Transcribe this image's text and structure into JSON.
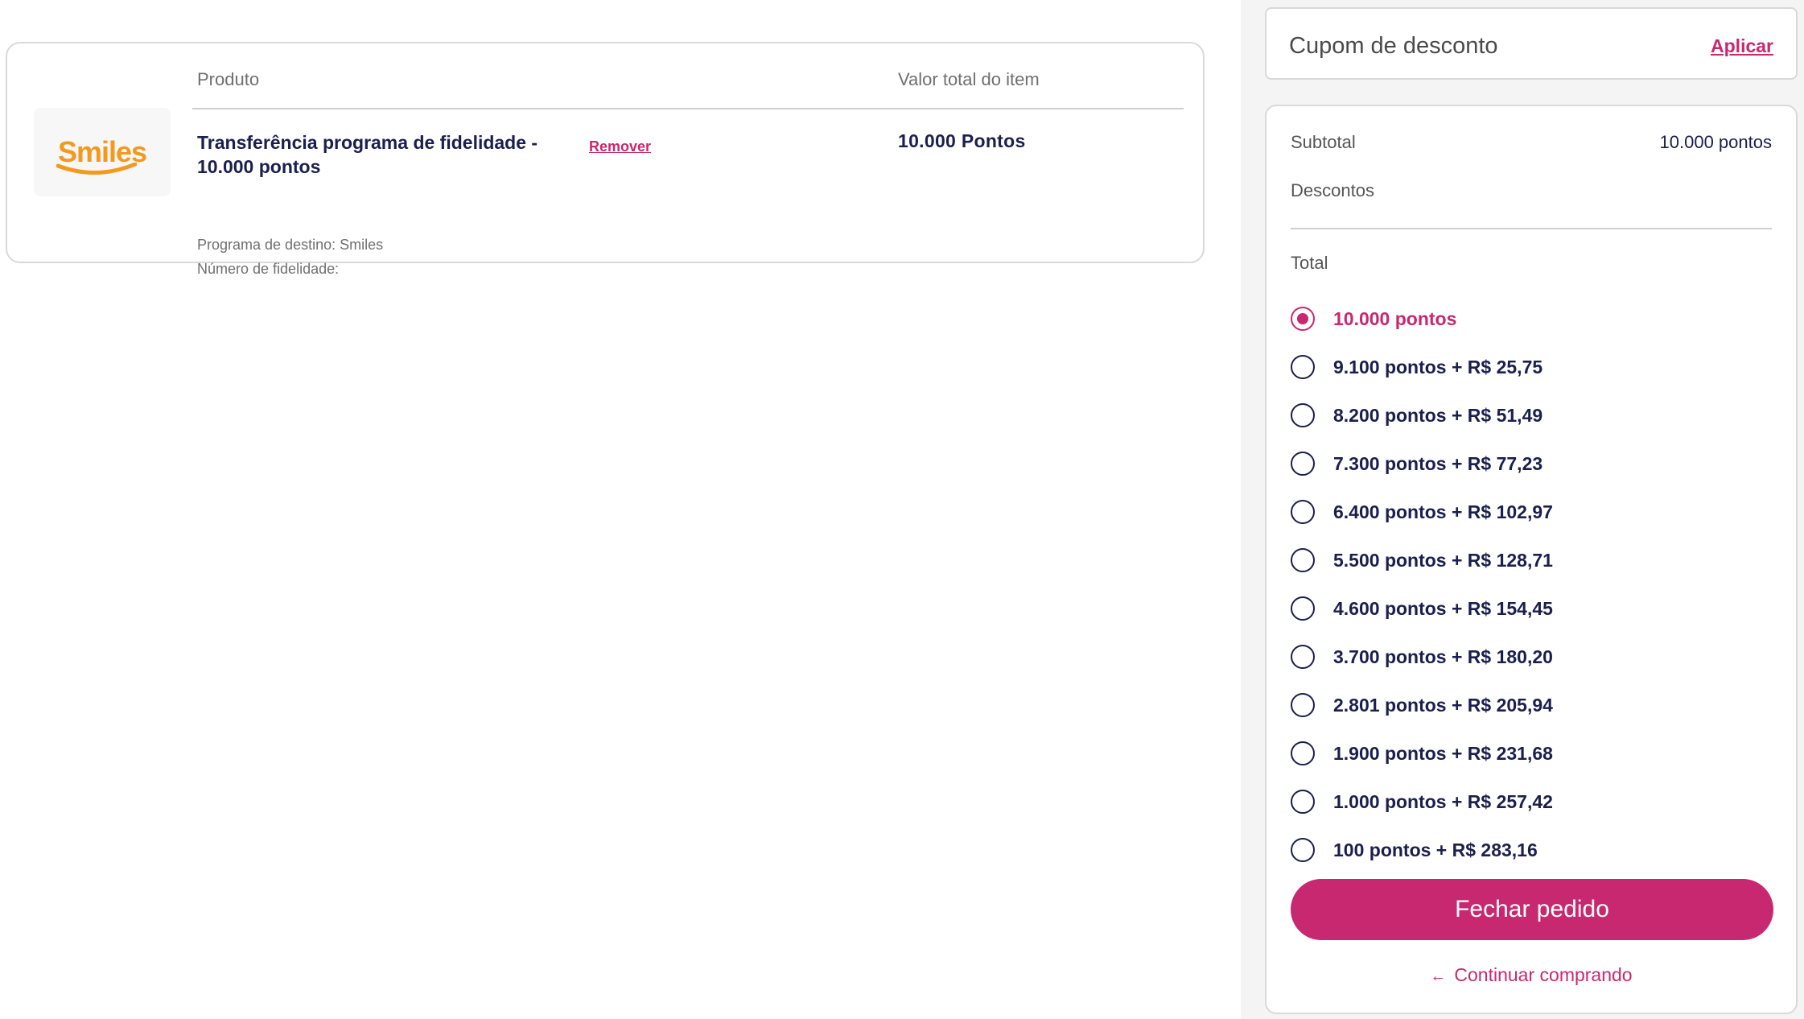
{
  "cart": {
    "header": {
      "produto": "Produto",
      "valor": "Valor total do item"
    },
    "item": {
      "logo_text": "Smiles",
      "title": "Transferência programa de fidelidade - 10.000 pontos",
      "remove_label": "Remover",
      "price": "10.000 Pontos",
      "program_destination": "Programa de destino: Smiles",
      "loyalty_number": "Número de fidelidade:"
    }
  },
  "coupon": {
    "label": "Cupom de desconto",
    "apply_label": "Aplicar"
  },
  "summary": {
    "subtotal_label": "Subtotal",
    "subtotal_value": "10.000 pontos",
    "descontos_label": "Descontos",
    "total_label": "Total",
    "options": [
      {
        "label": "10.000 pontos",
        "selected": true
      },
      {
        "label": "9.100 pontos + R$ 25,75",
        "selected": false
      },
      {
        "label": "8.200 pontos + R$ 51,49",
        "selected": false
      },
      {
        "label": "7.300 pontos + R$ 77,23",
        "selected": false
      },
      {
        "label": "6.400 pontos + R$ 102,97",
        "selected": false
      },
      {
        "label": "5.500 pontos + R$ 128,71",
        "selected": false
      },
      {
        "label": "4.600 pontos + R$ 154,45",
        "selected": false
      },
      {
        "label": "3.700 pontos + R$ 180,20",
        "selected": false
      },
      {
        "label": "2.801 pontos + R$ 205,94",
        "selected": false
      },
      {
        "label": "1.900 pontos + R$ 231,68",
        "selected": false
      },
      {
        "label": "1.000 pontos + R$ 257,42",
        "selected": false
      },
      {
        "label": "100 pontos + R$ 283,16",
        "selected": false
      }
    ],
    "checkout_label": "Fechar pedido",
    "continue_label": "Continuar comprando"
  },
  "colors": {
    "accent": "#c8286f",
    "text_dark": "#1a1f4d",
    "logo_orange": "#f29a1e"
  },
  "icons": {
    "continue": "arrow-left-icon"
  }
}
